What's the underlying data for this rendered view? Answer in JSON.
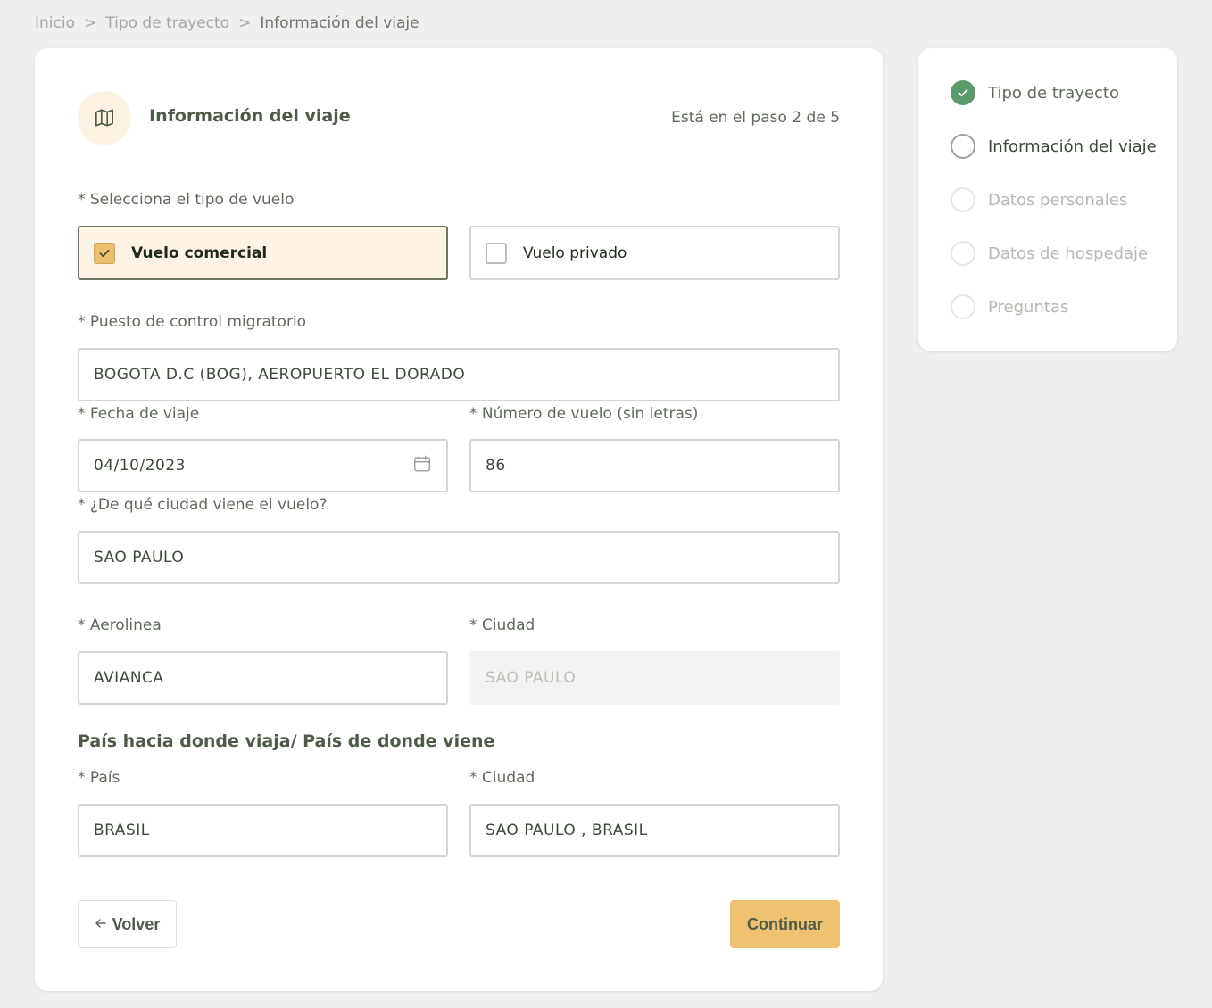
{
  "breadcrumb": {
    "items": [
      "Inicio",
      "Tipo de trayecto",
      "Información del viaje"
    ],
    "separator": ">"
  },
  "header": {
    "icon": "map-icon",
    "title": "Información del viaje",
    "step_indicator": "Está en el paso 2 de 5"
  },
  "flight_type": {
    "label": "* Selecciona el tipo de vuelo",
    "options": [
      {
        "label": "Vuelo comercial",
        "selected": true
      },
      {
        "label": "Vuelo privado",
        "selected": false
      }
    ]
  },
  "checkpoint": {
    "label": "* Puesto de control migratorio",
    "value": "BOGOTA D.C (BOG), AEROPUERTO EL DORADO"
  },
  "travel_date": {
    "label": "* Fecha de viaje",
    "value": "04/10/2023",
    "icon": "calendar-icon"
  },
  "flight_number": {
    "label": "* Número de vuelo (sin letras)",
    "value": "86"
  },
  "origin_city": {
    "label": "* ¿De qué ciudad viene el vuelo?",
    "value": "SAO PAULO"
  },
  "airline": {
    "label": "* Aerolinea",
    "value": "AVIANCA"
  },
  "airline_city": {
    "label": "* Ciudad",
    "value": "SAO PAULO"
  },
  "country_section": {
    "title": "País hacia donde viaja/ País de donde viene",
    "country": {
      "label": "* País",
      "value": "BRASIL"
    },
    "city": {
      "label": "* Ciudad",
      "value": "SAO PAULO , BRASIL"
    }
  },
  "actions": {
    "back_label": "Volver",
    "back_icon": "arrow-left-icon",
    "continue_label": "Continuar"
  },
  "colors": {
    "accent": "#edc16f",
    "selected_bg": "#fdf4e5",
    "done_green": "#5b9a6b"
  },
  "steps": [
    {
      "label": "Tipo de trayecto",
      "status": "done"
    },
    {
      "label": "Información del viaje",
      "status": "current"
    },
    {
      "label": "Datos personales",
      "status": "pending"
    },
    {
      "label": "Datos de hospedaje",
      "status": "pending"
    },
    {
      "label": "Preguntas",
      "status": "pending"
    }
  ]
}
